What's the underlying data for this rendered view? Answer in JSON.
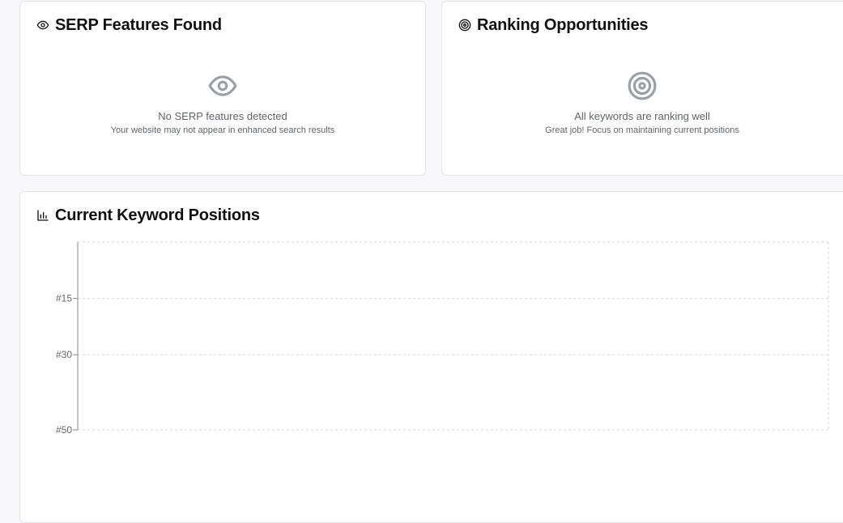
{
  "serp_card": {
    "title": "SERP Features Found",
    "header_icon": "eye-icon",
    "empty_icon": "eye-icon",
    "empty_title": "No SERP features detected",
    "empty_subtitle": "Your website may not appear in enhanced search results"
  },
  "ranking_card": {
    "title": "Ranking Opportunities",
    "header_icon": "target-icon",
    "empty_icon": "target-icon",
    "empty_title": "All keywords are ranking well",
    "empty_subtitle": "Great job! Focus on maintaining current positions"
  },
  "chart_card": {
    "title": "Current Keyword Positions",
    "header_icon": "bar-chart-icon"
  },
  "chart_data": {
    "type": "bar",
    "categories": [],
    "values": [],
    "y_reversed": true,
    "yticks": [
      {
        "value": 15,
        "label": "#15"
      },
      {
        "value": 30,
        "label": "#30"
      },
      {
        "value": 50,
        "label": "#50"
      }
    ],
    "ylim": [
      0,
      50
    ],
    "grid": true
  },
  "colors": {
    "icon_muted": "#9aa0a6",
    "grid": "#d9d9de",
    "axis": "#888888"
  }
}
